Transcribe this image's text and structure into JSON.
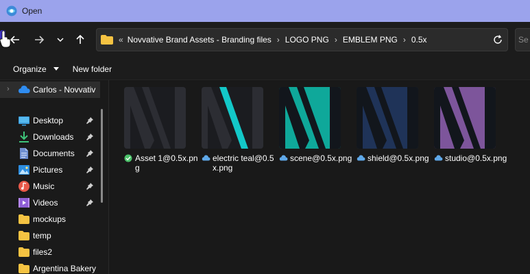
{
  "window": {
    "title": "Open"
  },
  "address": {
    "overflow": "«",
    "crumbs": [
      "Novvative Brand Assets - Branding files",
      "LOGO PNG",
      "EMBLEM PNG",
      "0.5x"
    ]
  },
  "search": {
    "placeholder": "Se"
  },
  "commands": {
    "organize": "Organize",
    "new_folder": "New folder"
  },
  "sidebar": {
    "cloud": {
      "label": "Carlos - Novvativ"
    },
    "items": [
      {
        "label": "Desktop",
        "icon": "desktop-icon",
        "pinned": true
      },
      {
        "label": "Downloads",
        "icon": "download-icon",
        "pinned": true
      },
      {
        "label": "Documents",
        "icon": "documents-icon",
        "pinned": true
      },
      {
        "label": "Pictures",
        "icon": "pictures-icon",
        "pinned": true
      },
      {
        "label": "Music",
        "icon": "music-icon",
        "pinned": true
      },
      {
        "label": "Videos",
        "icon": "videos-icon",
        "pinned": true
      },
      {
        "label": "mockups",
        "icon": "folder-icon",
        "pinned": false
      },
      {
        "label": "temp",
        "icon": "folder-icon",
        "pinned": false
      },
      {
        "label": "files2",
        "icon": "folder-icon",
        "pinned": false
      },
      {
        "label": "Argentina Bakery",
        "icon": "folder-icon",
        "pinned": false
      }
    ]
  },
  "files": [
    {
      "name": "Asset 1@0.5x.png",
      "status": "synced",
      "bg": "#1b1c20",
      "stroke": "#2c2d33",
      "accent": "#2c2d33"
    },
    {
      "name": "electric teal@0.5x.png",
      "status": "cloud",
      "bg": "#1b1c20",
      "stroke": "#2c2d33",
      "accent": "#13c8c8"
    },
    {
      "name": "scene@0.5x.png",
      "status": "cloud",
      "bg": "#0fa89a",
      "stroke": "#12161c",
      "accent": "#12161c"
    },
    {
      "name": "shield@0.5x.png",
      "status": "cloud",
      "bg": "#1f3358",
      "stroke": "#12161c",
      "accent": "#12161c"
    },
    {
      "name": "studio@0.5x.png",
      "status": "cloud",
      "bg": "#7d559b",
      "stroke": "#12161c",
      "accent": "#12161c"
    }
  ],
  "colors": {
    "titlebar": "#9ba3ec",
    "background": "#191919",
    "folder": "#f5c342",
    "cloud": "#5fa8e8",
    "synced": "#4cc36b"
  }
}
